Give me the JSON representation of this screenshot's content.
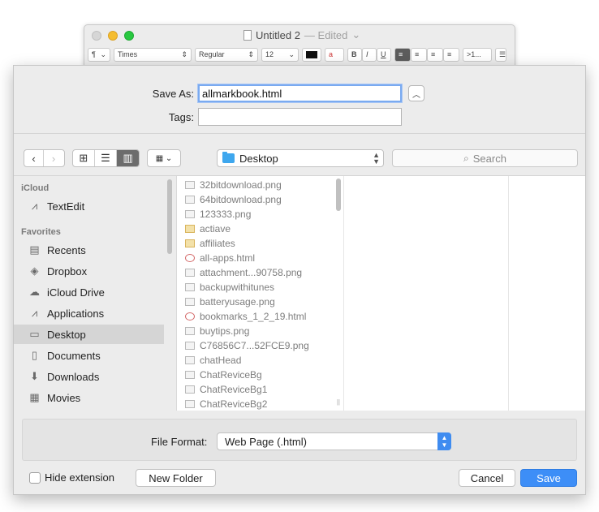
{
  "background_window": {
    "title": "Untitled 2",
    "status": "— Edited",
    "format_bar": {
      "paragraph_style": "¶",
      "font_family": "Times",
      "font_style": "Regular",
      "font_size": "12",
      "bold": "B",
      "italic": "I",
      "underline": "U",
      "spacing": ">1..."
    }
  },
  "save": {
    "save_as_label": "Save As:",
    "filename": "allmarkbook.html",
    "tags_label": "Tags:",
    "tags_value": ""
  },
  "toolbar": {
    "location": "Desktop",
    "search_placeholder": "Search"
  },
  "sidebar": {
    "sections": [
      {
        "heading": "iCloud",
        "items": [
          {
            "label": "TextEdit",
            "icon": "app-icon"
          }
        ]
      },
      {
        "heading": "Favorites",
        "items": [
          {
            "label": "Recents",
            "icon": "recents-icon"
          },
          {
            "label": "Dropbox",
            "icon": "dropbox-icon"
          },
          {
            "label": "iCloud Drive",
            "icon": "cloud-icon"
          },
          {
            "label": "Applications",
            "icon": "applications-icon"
          },
          {
            "label": "Desktop",
            "icon": "desktop-icon",
            "selected": true
          },
          {
            "label": "Documents",
            "icon": "documents-icon"
          },
          {
            "label": "Downloads",
            "icon": "downloads-icon"
          },
          {
            "label": "Movies",
            "icon": "movies-icon"
          }
        ]
      }
    ]
  },
  "files": [
    {
      "name": "32bitdownload.png",
      "kind": "image"
    },
    {
      "name": "64bitdownload.png",
      "kind": "image"
    },
    {
      "name": "123333.png",
      "kind": "image"
    },
    {
      "name": "actiave",
      "kind": "folder"
    },
    {
      "name": "affiliates",
      "kind": "folder"
    },
    {
      "name": "all-apps.html",
      "kind": "html"
    },
    {
      "name": "attachment...90758.png",
      "kind": "image"
    },
    {
      "name": "backupwithitunes",
      "kind": "image"
    },
    {
      "name": "batteryusage.png",
      "kind": "image"
    },
    {
      "name": "bookmarks_1_2_19.html",
      "kind": "html"
    },
    {
      "name": "buytips.png",
      "kind": "image"
    },
    {
      "name": "C76856C7...52FCE9.png",
      "kind": "image"
    },
    {
      "name": "chatHead",
      "kind": "image"
    },
    {
      "name": "ChatReviceBg",
      "kind": "image"
    },
    {
      "name": "ChatReviceBg1",
      "kind": "image"
    },
    {
      "name": "ChatReviceBg2",
      "kind": "image"
    }
  ],
  "format": {
    "label": "File Format:",
    "value": "Web Page (.html)"
  },
  "bottom": {
    "hide_extension_label": "Hide extension",
    "hide_extension_checked": false,
    "new_folder": "New Folder",
    "cancel": "Cancel",
    "save": "Save"
  },
  "colors": {
    "accent": "#3d8ef7",
    "sidebar_selected": "#d5d5d5"
  }
}
